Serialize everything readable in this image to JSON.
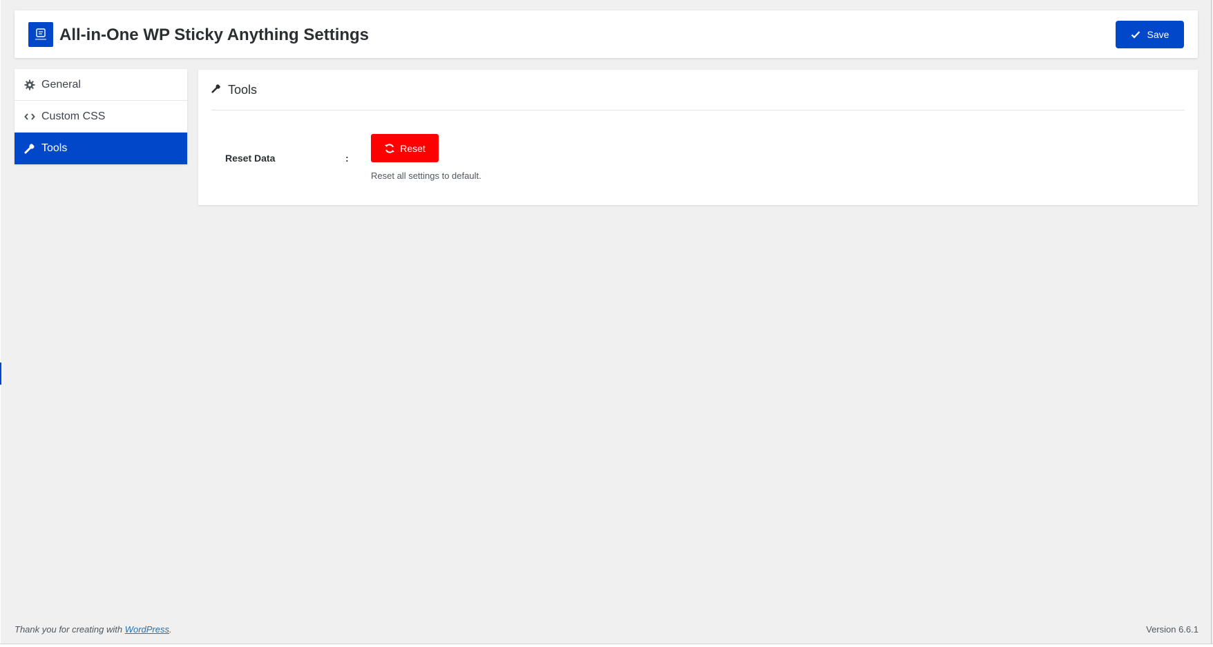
{
  "header": {
    "title": "All-in-One WP Sticky Anything Settings",
    "logo_icon": "sticky-anything-logo-icon",
    "save_label": "Save",
    "save_icon": "checkmark-icon"
  },
  "sidebar": {
    "items": [
      {
        "label": "General",
        "icon": "gear-icon",
        "active": false
      },
      {
        "label": "Custom CSS",
        "icon": "code-icon",
        "active": false
      },
      {
        "label": "Tools",
        "icon": "wrench-icon",
        "active": true
      }
    ]
  },
  "panel": {
    "title": "Tools",
    "icon": "wrench-icon",
    "rows": [
      {
        "label": "Reset Data",
        "separator": ":",
        "button_label": "Reset",
        "button_icon": "refresh-icon",
        "help": "Reset all settings to default."
      }
    ]
  },
  "footer": {
    "thanks_prefix": "Thank you for creating with ",
    "thanks_link": "WordPress",
    "thanks_suffix": ".",
    "version": "Version 6.6.1"
  },
  "colors": {
    "accent": "#0147c9",
    "danger": "#ff0000",
    "background": "#f0f0f0"
  }
}
